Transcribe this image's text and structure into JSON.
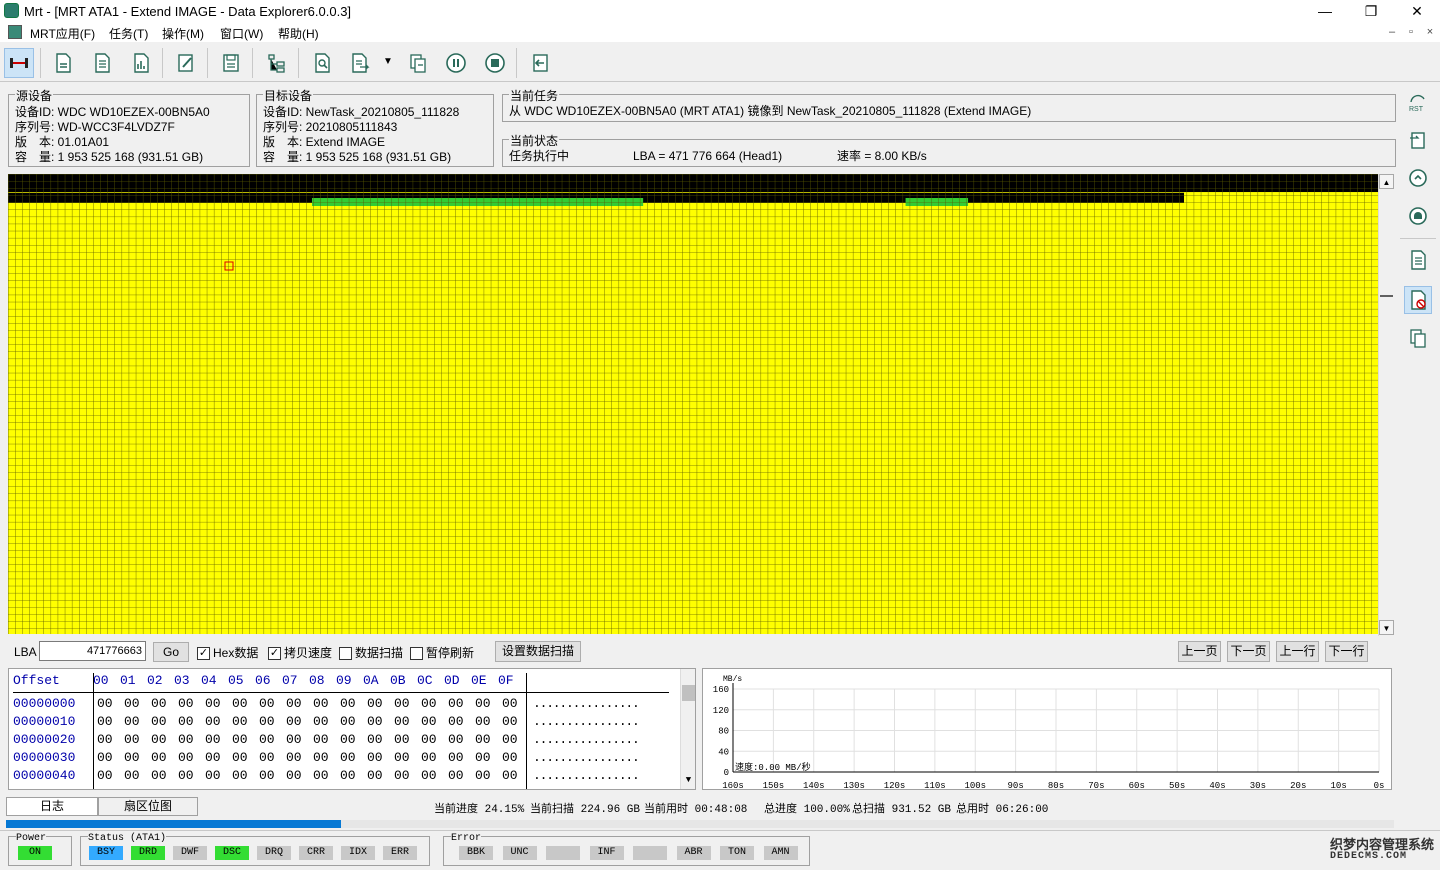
{
  "window": {
    "title": "Mrt - [MRT ATA1 - Extend IMAGE - Data Explorer6.0.0.3]",
    "min": "—",
    "max": "❐",
    "close": "✕"
  },
  "menu": {
    "items": [
      "MRT应用(F)",
      "任务(T)",
      "操作(M)",
      "窗口(W)",
      "帮助(H)"
    ],
    "mdi": [
      "–",
      "▫",
      "×"
    ]
  },
  "toolbar": {
    "icons": [
      "connect-icon",
      "doc-icon",
      "doc-lines-icon",
      "chart-doc-icon",
      "edit-icon",
      "save-icon",
      "tree-icon",
      "doc-search-icon",
      "doc-arrow-icon",
      "dropdown-arrow-icon",
      "copy-icon",
      "pause-icon",
      "stop-icon",
      "exit-icon"
    ]
  },
  "source": {
    "title": "源设备",
    "lines": [
      "设备ID: WDC WD10EZEX-00BN5A0",
      "序列号: WD-WCC3F4LVDZ7F",
      "版　本: 01.01A01",
      "容　量: 1 953 525 168 (931.51 GB)"
    ]
  },
  "target": {
    "title": "目标设备",
    "lines": [
      "设备ID: NewTask_20210805_111828",
      "序列号: 20210805111843",
      "版　本: Extend IMAGE",
      "容　量: 1 953 525 168 (931.51 GB)"
    ]
  },
  "task": {
    "title": "当前任务",
    "text": "从 WDC WD10EZEX-00BN5A0 (MRT ATA1) 镜像到 NewTask_20210805_111828 (Extend IMAGE)"
  },
  "state": {
    "title": "当前状态",
    "status": "任务执行中",
    "lba": "LBA = 471 776 664 (Head1)",
    "speed": "速率 = 8.00 KB/s"
  },
  "colors": {
    "black": "#000000",
    "green": "#33cc33",
    "yellow": "#ffff00",
    "gridline": "#4d4d00"
  },
  "map": {
    "rows": {
      "black": 2,
      "mixed": 1
    },
    "green_ranges": [
      [
        50,
        103
      ],
      [
        145,
        155
      ]
    ],
    "mixed_row_black_until": 193
  },
  "controls": {
    "lba_label": "LBA",
    "lba_value": "471776663",
    "go": "Go",
    "hex_label": "Hex数据",
    "copy_speed_label": "拷贝速度",
    "scan_label": "数据扫描",
    "pause_refresh_label": "暂停刷新",
    "set_scan_label": "设置数据扫描",
    "prev_page": "上一页",
    "next_page": "下一页",
    "prev_line": "上一行",
    "next_line": "下一行"
  },
  "hex": {
    "header": "Offset",
    "columns": [
      "00",
      "01",
      "02",
      "03",
      "04",
      "05",
      "06",
      "07",
      "08",
      "09",
      "0A",
      "0B",
      "0C",
      "0D",
      "0E",
      "0F"
    ],
    "offsets": [
      "00000000",
      "00000010",
      "00000020",
      "00000030",
      "00000040"
    ],
    "byte": "00",
    "ascii": "................"
  },
  "graph": {
    "unit": "MB/s",
    "y_ticks": [
      "160",
      "120",
      "80",
      "40",
      "0"
    ],
    "x_ticks": [
      "160s",
      "150s",
      "140s",
      "130s",
      "120s",
      "110s",
      "100s",
      "90s",
      "80s",
      "70s",
      "60s",
      "50s",
      "40s",
      "30s",
      "20s",
      "10s",
      "0s"
    ],
    "speed_text": "速度:0.00 MB/秒"
  },
  "tabs": {
    "log": "日志",
    "sector_map": "扇区位图"
  },
  "progress": {
    "current": "当前进度 24.15%",
    "current_scan": "当前扫描 224.96 GB",
    "current_time": "当前用时 00:48:08",
    "total": "总进度 100.00%",
    "total_scan": "总扫描 931.52 GB",
    "total_time": "总用时 06:26:00",
    "fraction": 0.2415
  },
  "status": {
    "power_title": "Power",
    "power": "ON",
    "status_title": "Status (ATA1)",
    "status_items": [
      "BSY",
      "DRD",
      "DWF",
      "DSC",
      "DRQ",
      "CRR",
      "IDX",
      "ERR"
    ],
    "error_title": "Error",
    "error_items": [
      "BBK",
      "UNC",
      "",
      "INF",
      "",
      "ABR",
      "TON",
      "AMN"
    ]
  },
  "watermark": {
    "line1": "织梦内容管理系统",
    "line2": "DEDECMS.COM"
  }
}
